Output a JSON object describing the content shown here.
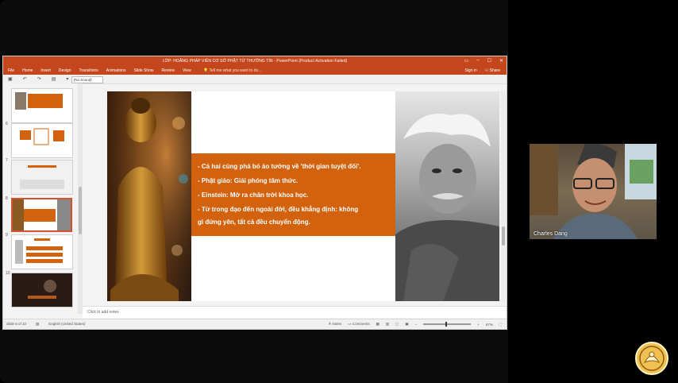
{
  "powerpoint": {
    "window_title": "LỚP: HOẰNG PHÁP VIÊN CƠ SỞ PHẬT TỬ THƯỜNG TÍN - PowerPoint (Product Activation Failed)",
    "ribbon_tabs": [
      "File",
      "Home",
      "Insert",
      "Design",
      "Transitions",
      "Animations",
      "Slide Show",
      "Review",
      "View"
    ],
    "tell_me": "Tell me what you want to do...",
    "sign_in": "Sign in",
    "share": "Share",
    "sound_dropdown": "[No Sound]",
    "thumbnail_numbers": [
      "6",
      "7",
      "8",
      "9",
      "10"
    ],
    "slide": {
      "bullets": [
        "- Cả hai cùng phá bỏ ảo tưởng về 'thời gian tuyệt đối'.",
        "- Phật giáo: Giải phóng tâm thức.",
        "- Einstein: Mở ra chân trời khoa học.",
        "- Từ trong đạo đến ngoài đời, đều khẳng định: không",
        "  gì đứng yên, tất cả đều chuyển động."
      ]
    },
    "notes_placeholder": "Click to add notes",
    "status": {
      "slide_counter": "Slide 8 of 10",
      "language": "English (United States)",
      "notes_btn": "Notes",
      "comments_btn": "Comments",
      "zoom": "67%"
    }
  },
  "participant": {
    "name": "Charles Dang"
  },
  "colors": {
    "accent": "#c4461d",
    "slide_box": "#d3620f"
  }
}
